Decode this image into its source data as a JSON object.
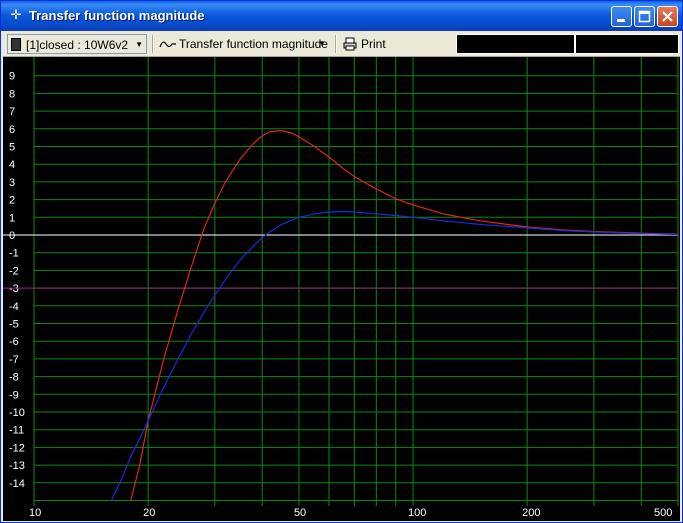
{
  "window": {
    "title": "Transfer function magnitude",
    "title_icon": "crosshair-icon",
    "buttons": [
      "minimize-button",
      "maximize-button",
      "close-button"
    ]
  },
  "toolbar": {
    "driver_select": "[1]closed : 10W6v2",
    "view_select": "Transfer function magnitude",
    "print_label": "Print",
    "status_left": "",
    "status_right": ""
  },
  "colors": {
    "plot_background": "#000000",
    "grid": "#0B8A0B",
    "zero_line": "#FFFFFF",
    "reference_line": "#A0208A",
    "series_red": "#E0261A",
    "series_blue": "#1A2AE0",
    "axis_text": "#FFFFFF"
  },
  "chart_data": {
    "type": "line",
    "xscale": "log",
    "xlim": [
      10,
      500
    ],
    "ylim": [
      -15,
      10
    ],
    "x_tick_labels": [
      "10",
      "20",
      "50",
      "100",
      "200",
      "500"
    ],
    "x_gridlines": [
      10,
      20,
      30,
      40,
      50,
      60,
      70,
      80,
      90,
      100,
      200,
      300,
      400,
      500
    ],
    "y_tick_labels": [
      "9",
      "8",
      "7",
      "6",
      "5",
      "4",
      "3",
      "2",
      "1",
      "0",
      "-1",
      "-2",
      "-3",
      "-4",
      "-5",
      "-6",
      "-7",
      "-8",
      "-9",
      "-10",
      "-11",
      "-12",
      "-13",
      "-14"
    ],
    "reference_line_y": -3,
    "grid": true,
    "series": [
      {
        "color": "#E0261A",
        "x": [
          18,
          19,
          20,
          22,
          24,
          26,
          28,
          30,
          32,
          35,
          38,
          40,
          42,
          45,
          48,
          50,
          55,
          60,
          65,
          70,
          80,
          90,
          100,
          120,
          150,
          200,
          250,
          300,
          400,
          500
        ],
        "y": [
          -15,
          -13,
          -10.5,
          -7,
          -4.2,
          -1.8,
          0.3,
          1.8,
          3.0,
          4.3,
          5.2,
          5.6,
          5.85,
          5.9,
          5.75,
          5.55,
          5.0,
          4.4,
          3.8,
          3.3,
          2.6,
          2.05,
          1.7,
          1.2,
          0.8,
          0.45,
          0.28,
          0.2,
          0.1,
          0.05
        ]
      },
      {
        "color": "#1A2AE0",
        "x": [
          16,
          17,
          18,
          19,
          20,
          22,
          24,
          26,
          28,
          30,
          32,
          35,
          38,
          40,
          42,
          45,
          50,
          55,
          60,
          65,
          70,
          80,
          90,
          100,
          120,
          150,
          200,
          250,
          300,
          400,
          500
        ],
        "y": [
          -15,
          -13.8,
          -12.5,
          -11.5,
          -10.5,
          -8.6,
          -7.0,
          -5.6,
          -4.4,
          -3.4,
          -2.5,
          -1.4,
          -0.6,
          -0.15,
          0.2,
          0.6,
          1.0,
          1.2,
          1.3,
          1.33,
          1.3,
          1.2,
          1.1,
          1.0,
          0.8,
          0.6,
          0.4,
          0.25,
          0.17,
          0.08,
          0.03
        ]
      }
    ]
  }
}
